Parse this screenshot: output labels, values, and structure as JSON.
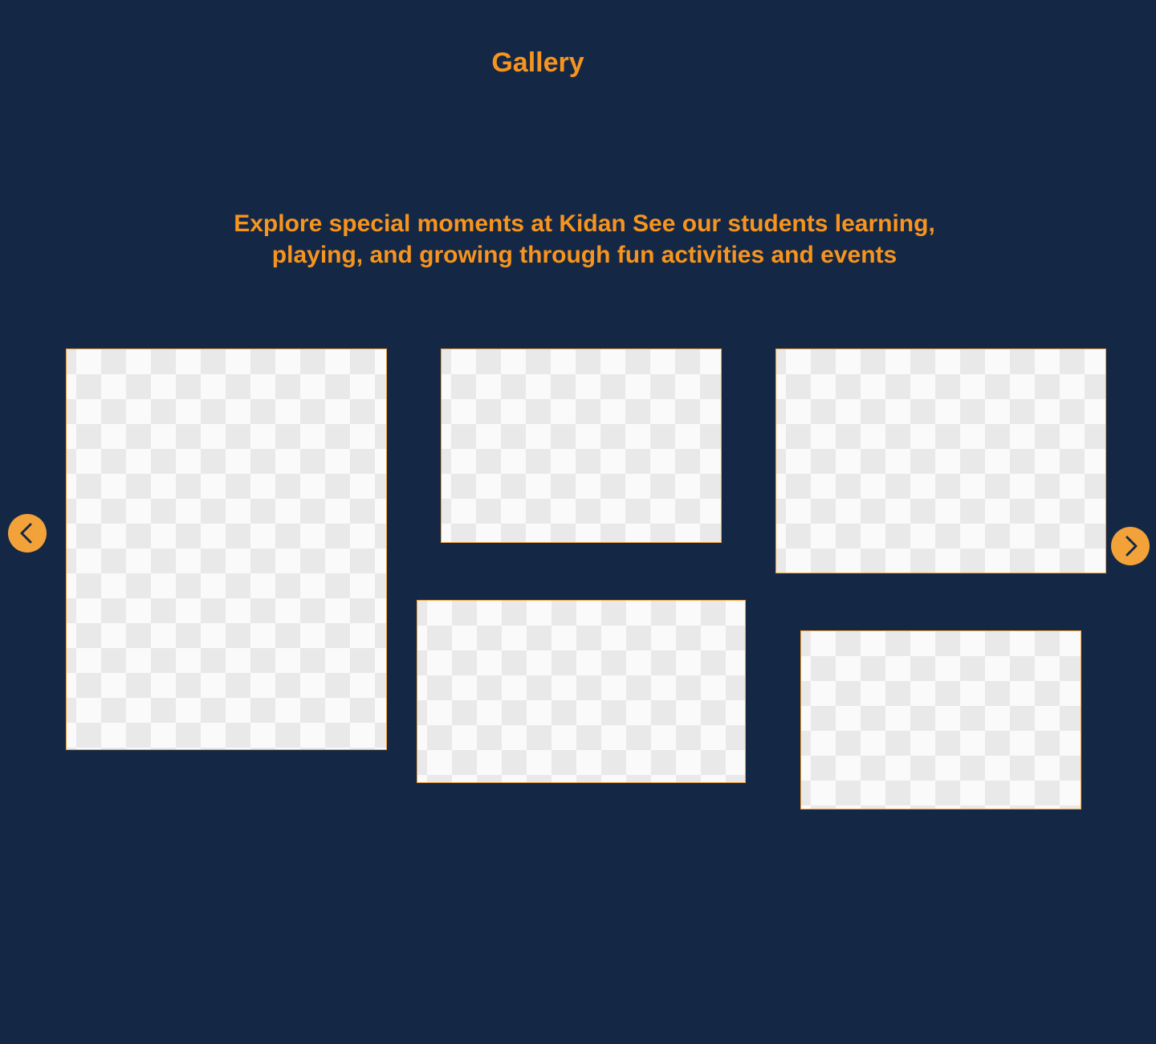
{
  "colors": {
    "background": "#142846",
    "accent": "#f7941d",
    "button": "#f3a23a",
    "chevron": "#142846"
  },
  "gallery": {
    "title": "Gallery",
    "subtitle_line1": "Explore special moments at Kidan See our students learning,",
    "subtitle_line2": "playing, and growing through fun activities and events",
    "photo_count": 5
  },
  "carousel": {
    "prev_icon": "chevron-left-icon",
    "next_icon": "chevron-right-icon"
  }
}
